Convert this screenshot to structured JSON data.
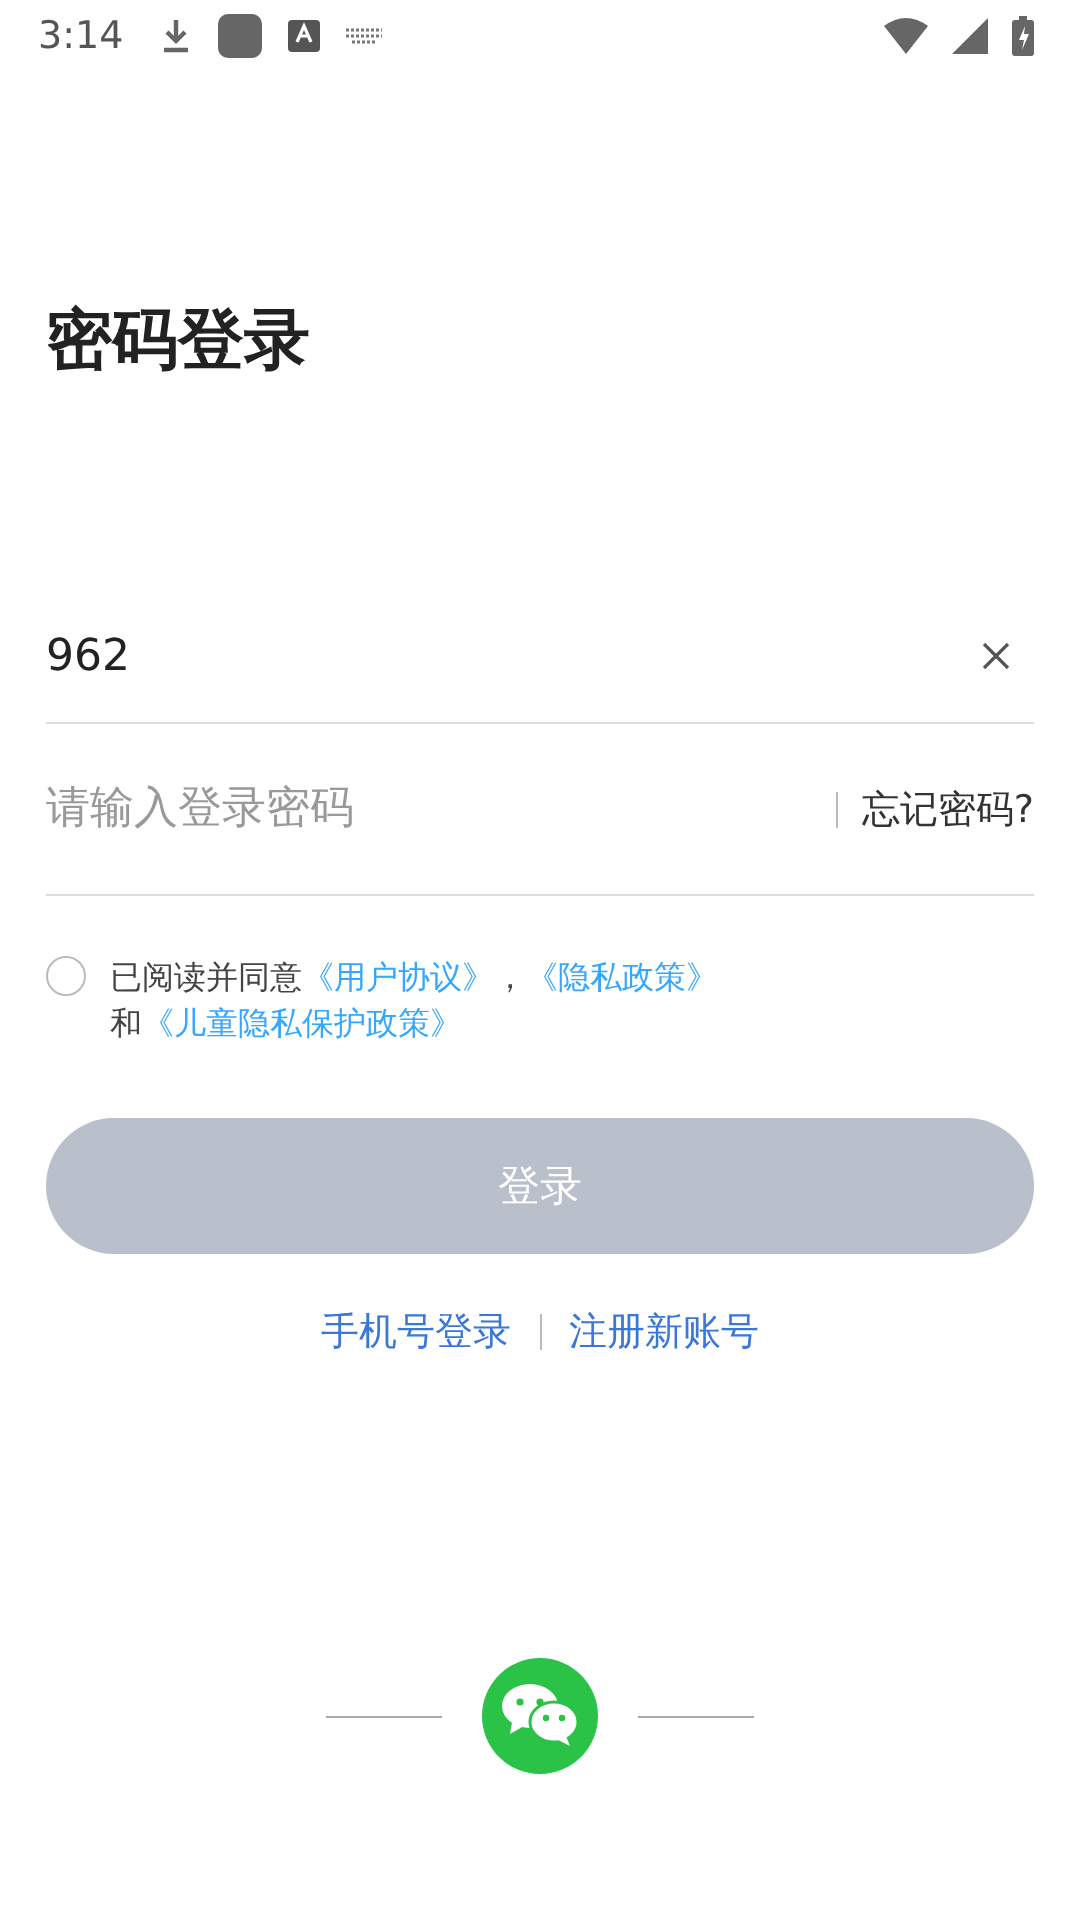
{
  "status_bar": {
    "time": "3:14"
  },
  "title": "密码登录",
  "phone_field": {
    "value": "962"
  },
  "password_field": {
    "placeholder": "请输入登录密码",
    "forgot_link": "忘记密码?"
  },
  "agreement": {
    "checked": false,
    "lines": [
      [
        {
          "kind": "plain",
          "text": "已阅读并同意"
        },
        {
          "kind": "link",
          "text": "《用户协议》"
        },
        {
          "kind": "plain",
          "text": "，"
        },
        {
          "kind": "link",
          "text": "《隐私政策》"
        }
      ],
      [
        {
          "kind": "plain",
          "text": "和"
        },
        {
          "kind": "link",
          "text": "《儿童隐私保护政策》"
        }
      ]
    ]
  },
  "login_button": {
    "label": "登录",
    "disabled": true
  },
  "alt_links": [
    {
      "label": "手机号登录"
    },
    {
      "label": "注册新账号"
    }
  ]
}
